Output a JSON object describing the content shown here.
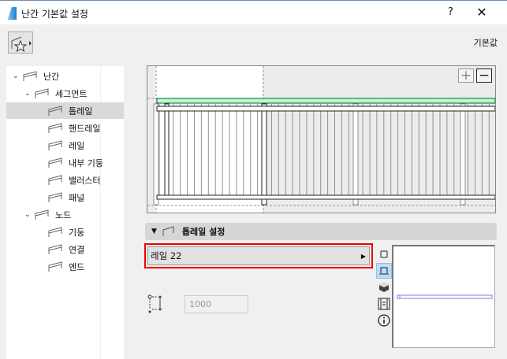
{
  "window": {
    "title": "난간 기본값 설정",
    "help": "?",
    "close": "✕"
  },
  "header": {
    "defaults_label": "기본값"
  },
  "tree": [
    {
      "label": "난간",
      "level": 0,
      "expanded": true,
      "icon": "railing-icon"
    },
    {
      "label": "세그먼트",
      "level": 1,
      "expanded": true,
      "icon": "segment-icon"
    },
    {
      "label": "톱레일",
      "level": 2,
      "selected": true,
      "icon": "toprail-icon"
    },
    {
      "label": "핸드레일",
      "level": 2,
      "icon": "handrail-icon"
    },
    {
      "label": "레일",
      "level": 2,
      "icon": "rail-icon"
    },
    {
      "label": "내부 기둥",
      "level": 2,
      "icon": "inner-post-icon"
    },
    {
      "label": "밸러스터",
      "level": 2,
      "icon": "baluster-icon"
    },
    {
      "label": "패널",
      "level": 2,
      "icon": "panel-icon"
    },
    {
      "label": "노드",
      "level": 1,
      "expanded": true,
      "icon": "node-icon"
    },
    {
      "label": "기둥",
      "level": 2,
      "icon": "post-icon"
    },
    {
      "label": "연결",
      "level": 2,
      "icon": "connection-icon"
    },
    {
      "label": "엔드",
      "level": 2,
      "icon": "end-icon"
    }
  ],
  "preview": {
    "zoom_in": "+",
    "zoom_out": "−",
    "highlight_color": "#b3ffcc"
  },
  "section": {
    "title": "톱레일 설정"
  },
  "rail": {
    "selected": "레일 22"
  },
  "height": {
    "value": "1000"
  }
}
